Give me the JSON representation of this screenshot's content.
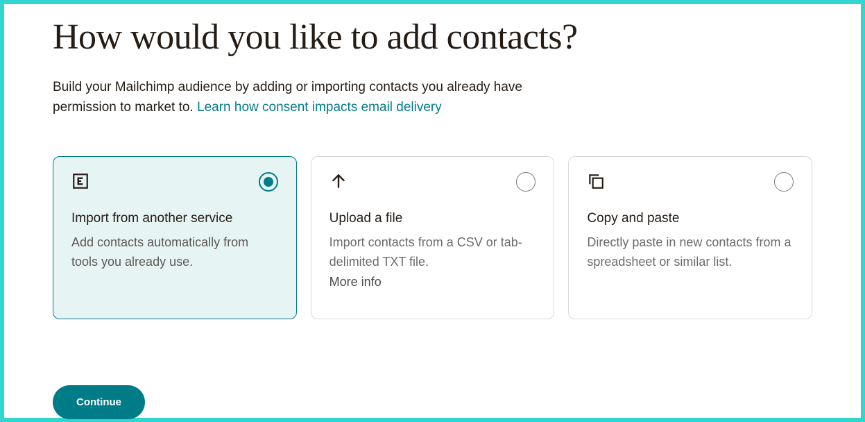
{
  "header": {
    "title": "How would you like to add contacts?",
    "subtitle_pre": "Build your Mailchimp audience by adding or importing contacts you already have permission to market to. ",
    "subtitle_link": "Learn how consent impacts email delivery"
  },
  "options": [
    {
      "id": "import-service",
      "icon": "import-service-icon",
      "title": "Import from another service",
      "desc": "Add contacts automatically from tools you already use.",
      "more": null,
      "selected": true
    },
    {
      "id": "upload-file",
      "icon": "upload-arrow-icon",
      "title": "Upload a file",
      "desc": "Import contacts from a CSV or tab-delimited TXT file.",
      "more": "More info",
      "selected": false
    },
    {
      "id": "copy-paste",
      "icon": "copy-paste-icon",
      "title": "Copy and paste",
      "desc": "Directly paste in new contacts from a spreadsheet or similar list.",
      "more": null,
      "selected": false
    }
  ],
  "actions": {
    "continue_label": "Continue"
  }
}
